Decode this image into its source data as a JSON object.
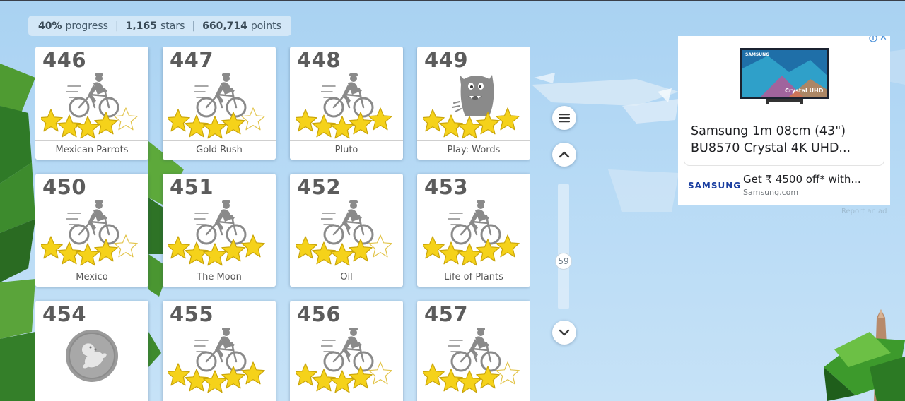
{
  "stats": {
    "progress_value": "40%",
    "progress_label": "progress",
    "stars_value": "1,165",
    "stars_label": "stars",
    "points_value": "660,714",
    "points_label": "points"
  },
  "levels": [
    {
      "number": "446",
      "name": "Mexican Parrots",
      "icon": "cyclist-icon",
      "stars": 4
    },
    {
      "number": "447",
      "name": "Gold Rush",
      "icon": "cyclist-icon",
      "stars": 4
    },
    {
      "number": "448",
      "name": "Pluto",
      "icon": "cyclist-icon",
      "stars": 5
    },
    {
      "number": "449",
      "name": "Play: Words",
      "icon": "monster-icon",
      "stars": 5
    },
    {
      "number": "450",
      "name": "Mexico",
      "icon": "cyclist-icon",
      "stars": 4
    },
    {
      "number": "451",
      "name": "The Moon",
      "icon": "cyclist-icon",
      "stars": 5
    },
    {
      "number": "452",
      "name": "Oil",
      "icon": "cyclist-icon",
      "stars": 4
    },
    {
      "number": "453",
      "name": "Life of Plants",
      "icon": "cyclist-icon",
      "stars": 5
    },
    {
      "number": "454",
      "name": "",
      "icon": "locked-coin-icon",
      "stars": 0
    },
    {
      "number": "455",
      "name": "",
      "icon": "cyclist-icon",
      "stars": 5
    },
    {
      "number": "456",
      "name": "",
      "icon": "cyclist-icon",
      "stars": 4
    },
    {
      "number": "457",
      "name": "",
      "icon": "cyclist-icon",
      "stars": 4
    }
  ],
  "scroll": {
    "position_label": "59",
    "menu_icon": "menu-icon",
    "up_icon": "chevron-up-icon",
    "down_icon": "chevron-down-icon"
  },
  "ad": {
    "headline": "Samsung 1m 08cm (43\") BU8570 Crystal 4K UHD...",
    "tv_label": "Crystal UHD",
    "tv_brand": "SAMSUNG",
    "brand": "SAMSUNG",
    "offer": "Get ₹ 4500 off* with...",
    "domain": "Samsung.com",
    "report": "Report an ad"
  },
  "colors": {
    "star_fill": "#f5d21a",
    "star_stroke": "#c9a50a",
    "icon_gray": "#8a8a8a",
    "sky": "#b3d7f3",
    "leaf_green": "#3f8f2d"
  }
}
